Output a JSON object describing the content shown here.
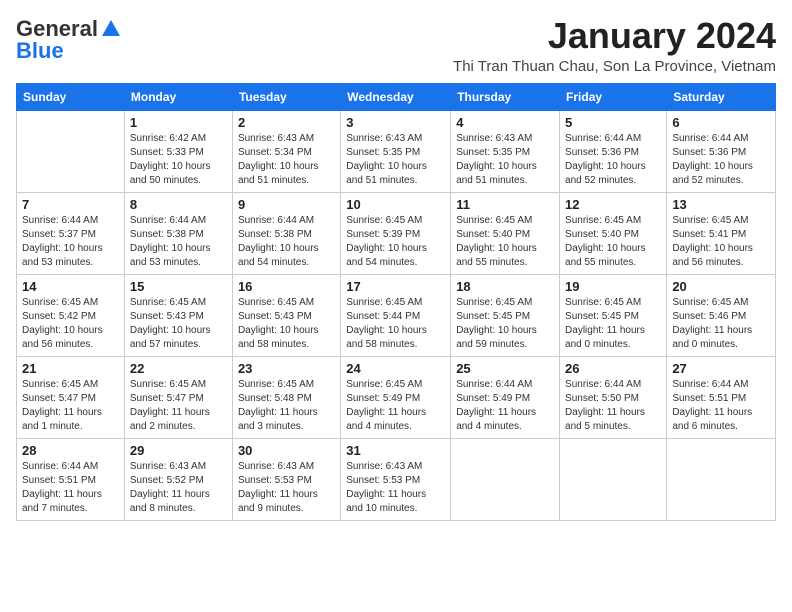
{
  "header": {
    "logo_general": "General",
    "logo_blue": "Blue",
    "month_title": "January 2024",
    "location": "Thi Tran Thuan Chau, Son La Province, Vietnam"
  },
  "weekdays": [
    "Sunday",
    "Monday",
    "Tuesday",
    "Wednesday",
    "Thursday",
    "Friday",
    "Saturday"
  ],
  "weeks": [
    [
      {
        "day": "",
        "sunrise": "",
        "sunset": "",
        "daylight": ""
      },
      {
        "day": "1",
        "sunrise": "Sunrise: 6:42 AM",
        "sunset": "Sunset: 5:33 PM",
        "daylight": "Daylight: 10 hours and 50 minutes."
      },
      {
        "day": "2",
        "sunrise": "Sunrise: 6:43 AM",
        "sunset": "Sunset: 5:34 PM",
        "daylight": "Daylight: 10 hours and 51 minutes."
      },
      {
        "day": "3",
        "sunrise": "Sunrise: 6:43 AM",
        "sunset": "Sunset: 5:35 PM",
        "daylight": "Daylight: 10 hours and 51 minutes."
      },
      {
        "day": "4",
        "sunrise": "Sunrise: 6:43 AM",
        "sunset": "Sunset: 5:35 PM",
        "daylight": "Daylight: 10 hours and 51 minutes."
      },
      {
        "day": "5",
        "sunrise": "Sunrise: 6:44 AM",
        "sunset": "Sunset: 5:36 PM",
        "daylight": "Daylight: 10 hours and 52 minutes."
      },
      {
        "day": "6",
        "sunrise": "Sunrise: 6:44 AM",
        "sunset": "Sunset: 5:36 PM",
        "daylight": "Daylight: 10 hours and 52 minutes."
      }
    ],
    [
      {
        "day": "7",
        "sunrise": "Sunrise: 6:44 AM",
        "sunset": "Sunset: 5:37 PM",
        "daylight": "Daylight: 10 hours and 53 minutes."
      },
      {
        "day": "8",
        "sunrise": "Sunrise: 6:44 AM",
        "sunset": "Sunset: 5:38 PM",
        "daylight": "Daylight: 10 hours and 53 minutes."
      },
      {
        "day": "9",
        "sunrise": "Sunrise: 6:44 AM",
        "sunset": "Sunset: 5:38 PM",
        "daylight": "Daylight: 10 hours and 54 minutes."
      },
      {
        "day": "10",
        "sunrise": "Sunrise: 6:45 AM",
        "sunset": "Sunset: 5:39 PM",
        "daylight": "Daylight: 10 hours and 54 minutes."
      },
      {
        "day": "11",
        "sunrise": "Sunrise: 6:45 AM",
        "sunset": "Sunset: 5:40 PM",
        "daylight": "Daylight: 10 hours and 55 minutes."
      },
      {
        "day": "12",
        "sunrise": "Sunrise: 6:45 AM",
        "sunset": "Sunset: 5:40 PM",
        "daylight": "Daylight: 10 hours and 55 minutes."
      },
      {
        "day": "13",
        "sunrise": "Sunrise: 6:45 AM",
        "sunset": "Sunset: 5:41 PM",
        "daylight": "Daylight: 10 hours and 56 minutes."
      }
    ],
    [
      {
        "day": "14",
        "sunrise": "Sunrise: 6:45 AM",
        "sunset": "Sunset: 5:42 PM",
        "daylight": "Daylight: 10 hours and 56 minutes."
      },
      {
        "day": "15",
        "sunrise": "Sunrise: 6:45 AM",
        "sunset": "Sunset: 5:43 PM",
        "daylight": "Daylight: 10 hours and 57 minutes."
      },
      {
        "day": "16",
        "sunrise": "Sunrise: 6:45 AM",
        "sunset": "Sunset: 5:43 PM",
        "daylight": "Daylight: 10 hours and 58 minutes."
      },
      {
        "day": "17",
        "sunrise": "Sunrise: 6:45 AM",
        "sunset": "Sunset: 5:44 PM",
        "daylight": "Daylight: 10 hours and 58 minutes."
      },
      {
        "day": "18",
        "sunrise": "Sunrise: 6:45 AM",
        "sunset": "Sunset: 5:45 PM",
        "daylight": "Daylight: 10 hours and 59 minutes."
      },
      {
        "day": "19",
        "sunrise": "Sunrise: 6:45 AM",
        "sunset": "Sunset: 5:45 PM",
        "daylight": "Daylight: 11 hours and 0 minutes."
      },
      {
        "day": "20",
        "sunrise": "Sunrise: 6:45 AM",
        "sunset": "Sunset: 5:46 PM",
        "daylight": "Daylight: 11 hours and 0 minutes."
      }
    ],
    [
      {
        "day": "21",
        "sunrise": "Sunrise: 6:45 AM",
        "sunset": "Sunset: 5:47 PM",
        "daylight": "Daylight: 11 hours and 1 minute."
      },
      {
        "day": "22",
        "sunrise": "Sunrise: 6:45 AM",
        "sunset": "Sunset: 5:47 PM",
        "daylight": "Daylight: 11 hours and 2 minutes."
      },
      {
        "day": "23",
        "sunrise": "Sunrise: 6:45 AM",
        "sunset": "Sunset: 5:48 PM",
        "daylight": "Daylight: 11 hours and 3 minutes."
      },
      {
        "day": "24",
        "sunrise": "Sunrise: 6:45 AM",
        "sunset": "Sunset: 5:49 PM",
        "daylight": "Daylight: 11 hours and 4 minutes."
      },
      {
        "day": "25",
        "sunrise": "Sunrise: 6:44 AM",
        "sunset": "Sunset: 5:49 PM",
        "daylight": "Daylight: 11 hours and 4 minutes."
      },
      {
        "day": "26",
        "sunrise": "Sunrise: 6:44 AM",
        "sunset": "Sunset: 5:50 PM",
        "daylight": "Daylight: 11 hours and 5 minutes."
      },
      {
        "day": "27",
        "sunrise": "Sunrise: 6:44 AM",
        "sunset": "Sunset: 5:51 PM",
        "daylight": "Daylight: 11 hours and 6 minutes."
      }
    ],
    [
      {
        "day": "28",
        "sunrise": "Sunrise: 6:44 AM",
        "sunset": "Sunset: 5:51 PM",
        "daylight": "Daylight: 11 hours and 7 minutes."
      },
      {
        "day": "29",
        "sunrise": "Sunrise: 6:43 AM",
        "sunset": "Sunset: 5:52 PM",
        "daylight": "Daylight: 11 hours and 8 minutes."
      },
      {
        "day": "30",
        "sunrise": "Sunrise: 6:43 AM",
        "sunset": "Sunset: 5:53 PM",
        "daylight": "Daylight: 11 hours and 9 minutes."
      },
      {
        "day": "31",
        "sunrise": "Sunrise: 6:43 AM",
        "sunset": "Sunset: 5:53 PM",
        "daylight": "Daylight: 11 hours and 10 minutes."
      },
      {
        "day": "",
        "sunrise": "",
        "sunset": "",
        "daylight": ""
      },
      {
        "day": "",
        "sunrise": "",
        "sunset": "",
        "daylight": ""
      },
      {
        "day": "",
        "sunrise": "",
        "sunset": "",
        "daylight": ""
      }
    ]
  ]
}
